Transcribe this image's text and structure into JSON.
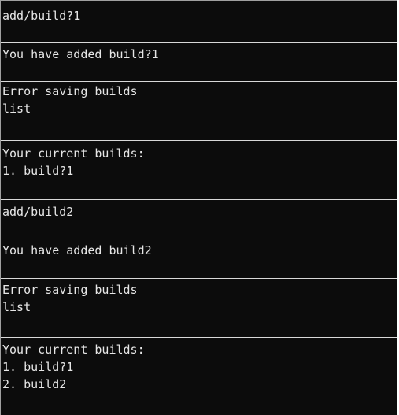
{
  "console": {
    "blocks": [
      {
        "lines": [
          "add/build?1"
        ]
      },
      {
        "lines": [
          "You have added build?1"
        ]
      },
      {
        "lines": [
          "Error saving builds",
          "list"
        ]
      },
      {
        "lines": [
          "Your current builds:",
          "1. build?1"
        ]
      },
      {
        "lines": [
          "add/build2"
        ]
      },
      {
        "lines": [
          "You have added build2"
        ]
      },
      {
        "lines": [
          "Error saving builds",
          "list"
        ]
      },
      {
        "lines": [
          "Your current builds:",
          "1. build?1",
          "2. build2"
        ]
      }
    ]
  },
  "colors": {
    "background": "#0c0c0c",
    "text": "#e6e6e6",
    "separator": "#d9d9d9"
  }
}
